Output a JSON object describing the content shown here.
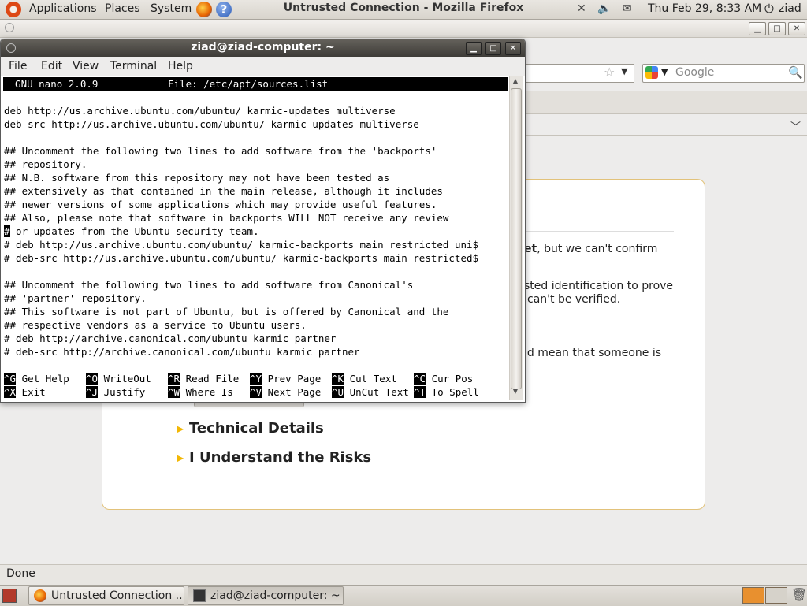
{
  "top_panel": {
    "menus": [
      "Applications",
      "Places",
      "System"
    ],
    "clock": "Thu Feb 29,  8:33 AM",
    "user": "ziad"
  },
  "firefox": {
    "title": "Untrusted Connection - Mozilla Firefox",
    "search_placeholder": "Google",
    "cert_lines": [
      "et, but we can't confirm",
      "sted identification to prove",
      "can't be verified.",
      "ld mean that someone is"
    ],
    "technical_details": "Technical Details",
    "understand_risks": "I Understand the Risks",
    "status": "Done"
  },
  "terminal": {
    "title": "ziad@ziad-computer: ~",
    "menus": [
      "File",
      "Edit",
      "View",
      "Terminal",
      "Help"
    ],
    "nano_version": "  GNU nano 2.0.9",
    "nano_file": "File: /etc/apt/sources.list",
    "lines": [
      "deb http://us.archive.ubuntu.com/ubuntu/ karmic-updates multiverse",
      "deb-src http://us.archive.ubuntu.com/ubuntu/ karmic-updates multiverse",
      "",
      "## Uncomment the following two lines to add software from the 'backports'",
      "## repository.",
      "## N.B. software from this repository may not have been tested as",
      "## extensively as that contained in the main release, although it includes",
      "## newer versions of some applications which may provide useful features.",
      "## Also, please note that software in backports WILL NOT receive any review",
      "# or updates from the Ubuntu security team.",
      "# deb http://us.archive.ubuntu.com/ubuntu/ karmic-backports main restricted uni$",
      "# deb-src http://us.archive.ubuntu.com/ubuntu/ karmic-backports main restricted$",
      "",
      "## Uncomment the following two lines to add software from Canonical's",
      "## 'partner' repository.",
      "## This software is not part of Ubuntu, but is offered by Canonical and the",
      "## respective vendors as a service to Ubuntu users.",
      "# deb http://archive.canonical.com/ubuntu karmic partner",
      "# deb-src http://archive.canonical.com/ubuntu karmic partner"
    ],
    "cursor_char": "#",
    "shortcuts_row1": [
      {
        "key": "^G",
        "label": " Get Help"
      },
      {
        "key": "^O",
        "label": " WriteOut"
      },
      {
        "key": "^R",
        "label": " Read File"
      },
      {
        "key": "^Y",
        "label": " Prev Page"
      },
      {
        "key": "^K",
        "label": " Cut Text"
      },
      {
        "key": "^C",
        "label": " Cur Pos"
      }
    ],
    "shortcuts_row2": [
      {
        "key": "^X",
        "label": " Exit"
      },
      {
        "key": "^J",
        "label": " Justify"
      },
      {
        "key": "^W",
        "label": " Where Is"
      },
      {
        "key": "^V",
        "label": " Next Page"
      },
      {
        "key": "^U",
        "label": " UnCut Text"
      },
      {
        "key": "^T",
        "label": " To Spell"
      }
    ]
  },
  "taskbar": {
    "tasks": [
      "Untrusted Connection ...",
      "ziad@ziad-computer: ~"
    ]
  }
}
